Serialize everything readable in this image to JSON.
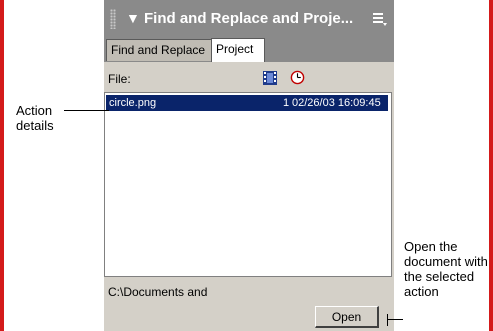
{
  "panel": {
    "title": "Find and Replace and Proje...",
    "tabs": [
      {
        "label": "Find and Replace",
        "active": false
      },
      {
        "label": "Project",
        "active": true
      }
    ],
    "file_label": "File:",
    "rows": [
      {
        "name": "circle.png",
        "count": "1",
        "date": "02/26/03 16:09:45",
        "selected": true
      }
    ],
    "path": "C:\\Documents and",
    "open_label": "Open"
  },
  "callouts": {
    "left": "Action details",
    "right": "Open the document with the selected action"
  },
  "colors": {
    "titlebar": "#8a8a8a",
    "selection": "#0a246a",
    "panel_bg": "#d4d0c8",
    "frame_border": "#d41a1a"
  }
}
